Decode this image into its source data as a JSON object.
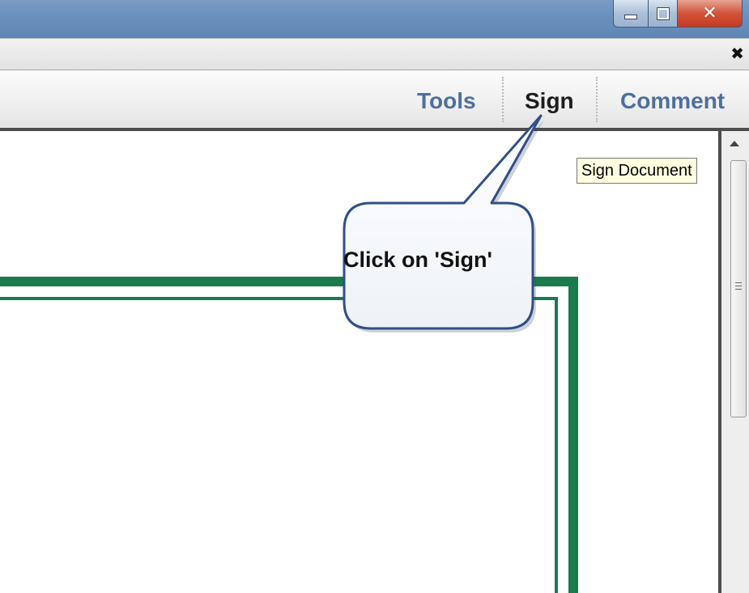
{
  "window_controls": {
    "minimize_icon": "minimize-icon",
    "maximize_icon": "restore-icon",
    "close_icon": "close-icon",
    "close_glyph": "✕"
  },
  "doc_strip": {
    "close_glyph": "✖"
  },
  "toolbar": {
    "tools_label": "Tools",
    "sign_label": "Sign",
    "comment_label": "Comment"
  },
  "tooltip": {
    "text": "Sign Document"
  },
  "callout": {
    "text": "Click on 'Sign'"
  },
  "colors": {
    "link_blue": "#4e6f9c",
    "border_green": "#1b7b4c",
    "callout_border": "#2f4f86",
    "tooltip_bg": "#ffffe1"
  }
}
